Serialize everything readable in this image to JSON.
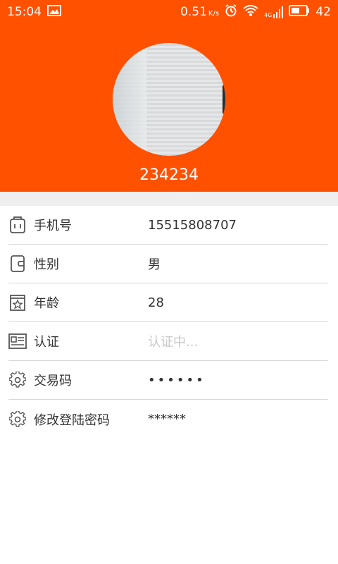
{
  "status_bar": {
    "time": "15:04",
    "net_speed": "0.51",
    "net_unit": "K/s",
    "network_type": "4G",
    "battery": "42",
    "icons": [
      "image-icon",
      "alarm-icon",
      "wifi-icon",
      "signal-icon",
      "battery-icon"
    ]
  },
  "profile": {
    "username": "234234"
  },
  "colors": {
    "header_bg": "#ff5100",
    "separator_band": "#efeff0",
    "divider": "#d9d9d9",
    "text": "#333333",
    "placeholder": "#c8c8c8"
  },
  "items": [
    {
      "label": "手机号",
      "value": "15515808707",
      "icon": "phone-icon"
    },
    {
      "label": "性别",
      "value": "男",
      "icon": "gender-icon"
    },
    {
      "label": "年龄",
      "value": "28",
      "icon": "calendar-star-icon"
    },
    {
      "label": "认证",
      "value": "认证中...",
      "icon": "id-card-icon"
    },
    {
      "label": "交易码",
      "value": "••••••",
      "icon": "gear-icon"
    },
    {
      "label": "修改登陆密码",
      "value": "******",
      "icon": "gear-icon"
    }
  ]
}
